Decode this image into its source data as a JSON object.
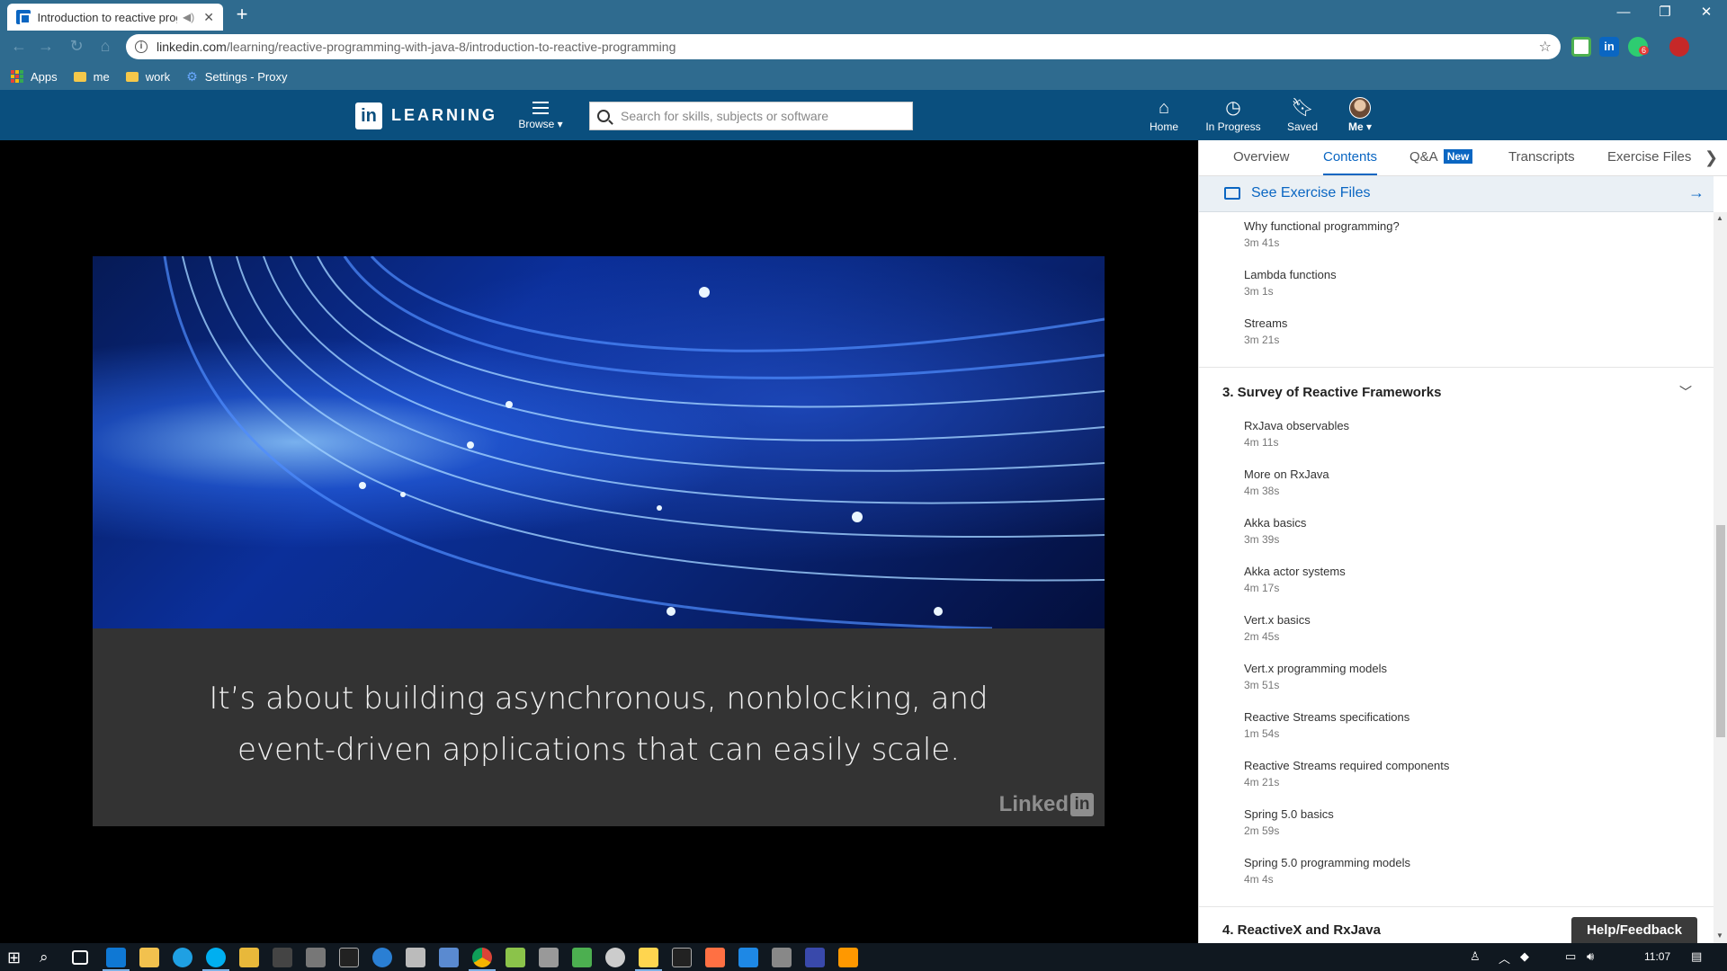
{
  "browser": {
    "tab_title": "Introduction to reactive prog",
    "tab_audio_icon": "speaker-icon",
    "tab_close": "✕",
    "new_tab": "+",
    "window_controls": [
      "—",
      "❐",
      "✕"
    ],
    "url_host": "linkedin.com",
    "url_path": "/learning/reactive-programming-with-java-8/introduction-to-reactive-programming",
    "bookmarks": [
      "Apps",
      "me",
      "work",
      "Settings - Proxy"
    ],
    "extension_badge": "6"
  },
  "header": {
    "logo_text": "in",
    "brand": "LEARNING",
    "browse_label": "Browse ▾",
    "search_placeholder": "Search for skills, subjects or software",
    "nav": [
      {
        "label": "Home",
        "icon": "home-icon"
      },
      {
        "label": "In Progress",
        "icon": "clock-icon"
      },
      {
        "label": "Saved",
        "icon": "bookmark-icon"
      },
      {
        "label": "Me ▾",
        "icon": "avatar"
      }
    ]
  },
  "video": {
    "caption_line1": "It’s about building asynchronous, nonblocking, and",
    "caption_line2": "event-driven applications that can easily scale.",
    "watermark": "Linked",
    "watermark_in": "in"
  },
  "panel": {
    "tabs": [
      "Overview",
      "Contents",
      "Q&A",
      "Transcripts",
      "Exercise Files"
    ],
    "active_tab": "Contents",
    "qa_badge": "New",
    "exercise_files_label": "See Exercise Files",
    "section2_items": [
      {
        "title": "Why functional programming?",
        "duration": "3m 41s"
      },
      {
        "title": "Lambda functions",
        "duration": "3m 1s"
      },
      {
        "title": "Streams",
        "duration": "3m 21s"
      }
    ],
    "section3_title": "3. Survey of Reactive Frameworks",
    "section3_items": [
      {
        "title": "RxJava observables",
        "duration": "4m 11s"
      },
      {
        "title": "More on RxJava",
        "duration": "4m 38s"
      },
      {
        "title": "Akka basics",
        "duration": "3m 39s"
      },
      {
        "title": "Akka actor systems",
        "duration": "4m 17s"
      },
      {
        "title": "Vert.x basics",
        "duration": "2m 45s"
      },
      {
        "title": "Vert.x programming models",
        "duration": "3m 51s"
      },
      {
        "title": "Reactive Streams specifications",
        "duration": "1m 54s"
      },
      {
        "title": "Reactive Streams required components",
        "duration": "4m 21s"
      },
      {
        "title": "Spring 5.0 basics",
        "duration": "2m 59s"
      },
      {
        "title": "Spring 5.0 programming models",
        "duration": "4m 4s"
      }
    ],
    "section4_title": "4. ReactiveX and RxJava",
    "help_label": "Help/Feedback"
  },
  "taskbar": {
    "clock": "11:07"
  },
  "colors": {
    "chrome": "#2f6b8f",
    "linkedin_header": "#0a4f7e",
    "accent": "#0a66c2"
  }
}
